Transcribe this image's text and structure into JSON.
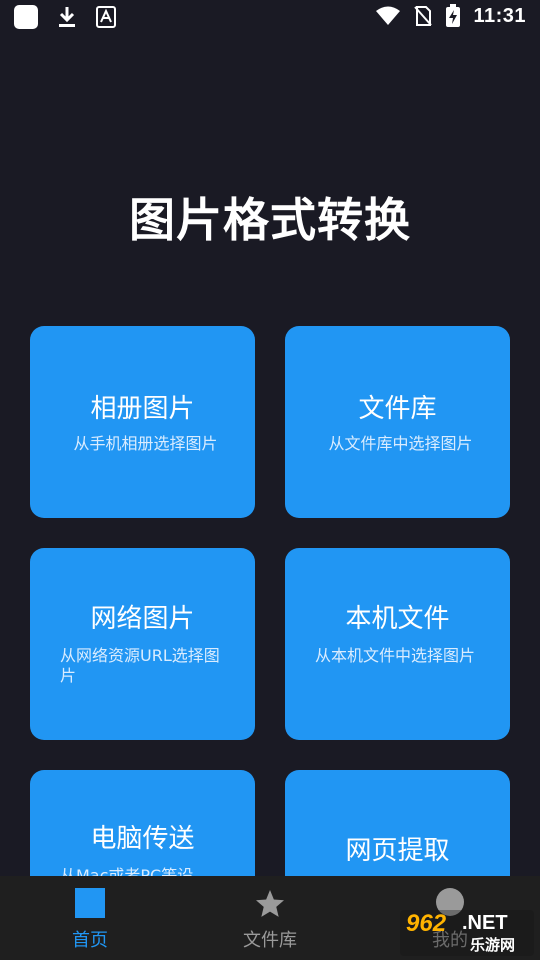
{
  "status_bar": {
    "time": "11:31"
  },
  "page_title": "图片格式转换",
  "cards": [
    {
      "title": "相册图片",
      "desc": "从手机相册选择图片"
    },
    {
      "title": "文件库",
      "desc": "从文件库中选择图片"
    },
    {
      "title": "网络图片",
      "desc": "从网络资源URL选择图片"
    },
    {
      "title": "本机文件",
      "desc": "从本机文件中选择图片"
    },
    {
      "title": "电脑传送",
      "desc": "从Mac或者PC等设"
    },
    {
      "title": "网页提取",
      "desc": ""
    }
  ],
  "bottom_nav": {
    "items": [
      {
        "label": "首页",
        "icon": "home-square-icon",
        "active": true
      },
      {
        "label": "文件库",
        "icon": "star-icon",
        "active": false
      },
      {
        "label": "我的",
        "icon": "person-icon",
        "active": false
      }
    ]
  },
  "watermark": {
    "brand_num": "962",
    "brand_suffix": ".NET",
    "brand_cn": "乐游网"
  },
  "colors": {
    "background": "#1a1a24",
    "card": "#2196f3",
    "nav_active": "#2196f3",
    "nav_inactive": "#9a9a9a"
  }
}
